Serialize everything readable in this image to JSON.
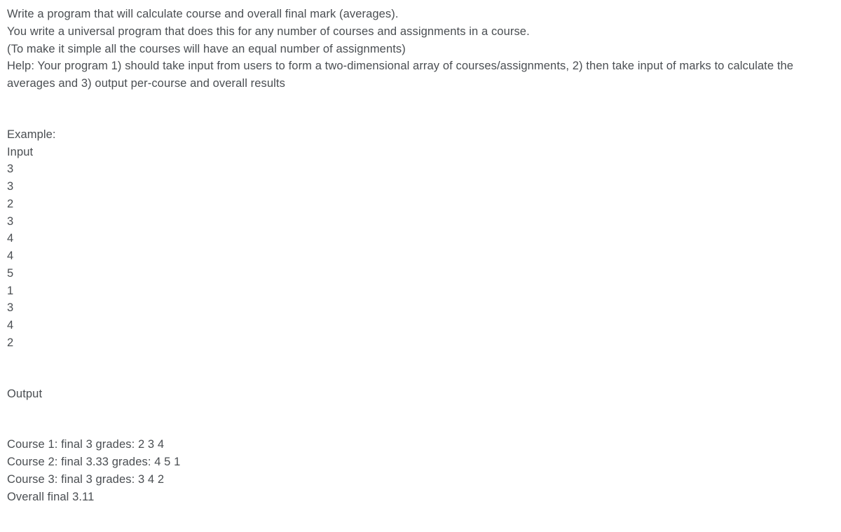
{
  "problem": {
    "line1": "Write a program that will calculate course and overall final mark (averages).",
    "line2": "You write a universal program that does this for any number of courses and assignments in a course.",
    "line3": "(To make it simple all the courses will have an equal number of assignments)",
    "line4": "Help: Your program 1) should take input from users to form a two-dimensional array of courses/assignments, 2) then take input of marks to calculate the averages and 3) output per-course and overall results"
  },
  "example": {
    "header": "Example:",
    "inputLabel": "Input",
    "inputs": [
      "3",
      "3",
      "2",
      "3",
      "4",
      "4",
      "5",
      "1",
      "3",
      "4",
      "2"
    ],
    "outputLabel": "Output",
    "outputs": [
      "Course 1: final 3 grades: 2 3 4",
      "Course 2: final 3.33 grades: 4 5 1",
      "Course 3: final 3 grades: 3 4 2",
      "Overall final 3.11"
    ]
  }
}
